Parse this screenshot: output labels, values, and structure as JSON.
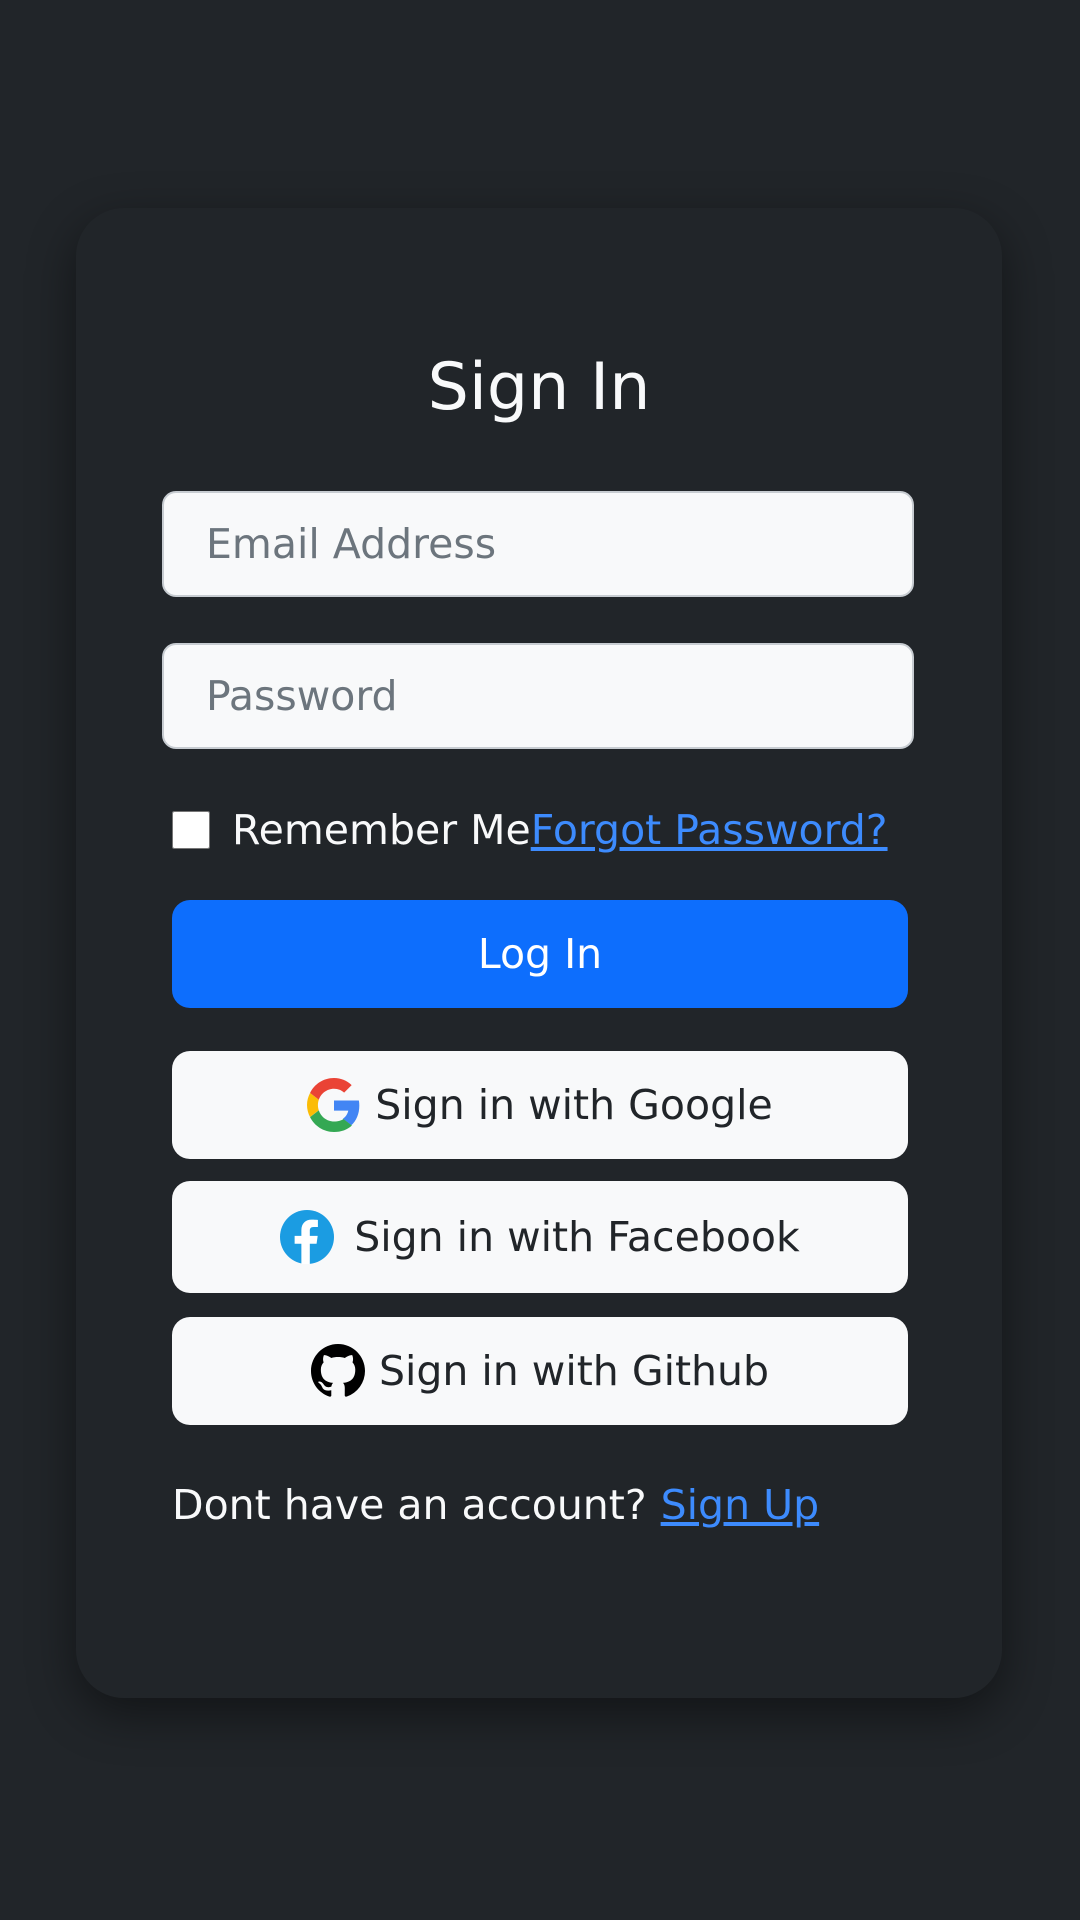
{
  "login_form": {
    "title": "Sign In",
    "email_placeholder": "Email Address",
    "password_placeholder": "Password",
    "remember_me_label": "Remember Me",
    "forgot_password_link": "Forgot Password?",
    "login_button": "Log In"
  },
  "social_login": {
    "google_label": "Sign in with Google",
    "facebook_label": "Sign in with Facebook",
    "github_label": "Sign in with Github",
    "icons": [
      "google-icon",
      "facebook-icon",
      "github-icon"
    ]
  },
  "footer": {
    "prompt": "Dont have an account?",
    "signup_link": "Sign Up"
  },
  "colors": {
    "background": "#212529",
    "primary": "#0d6efd",
    "link": "#3d8bfd",
    "input_background": "#f8f9fa",
    "text_light": "#f8f9fa",
    "text_dark": "#212529"
  }
}
